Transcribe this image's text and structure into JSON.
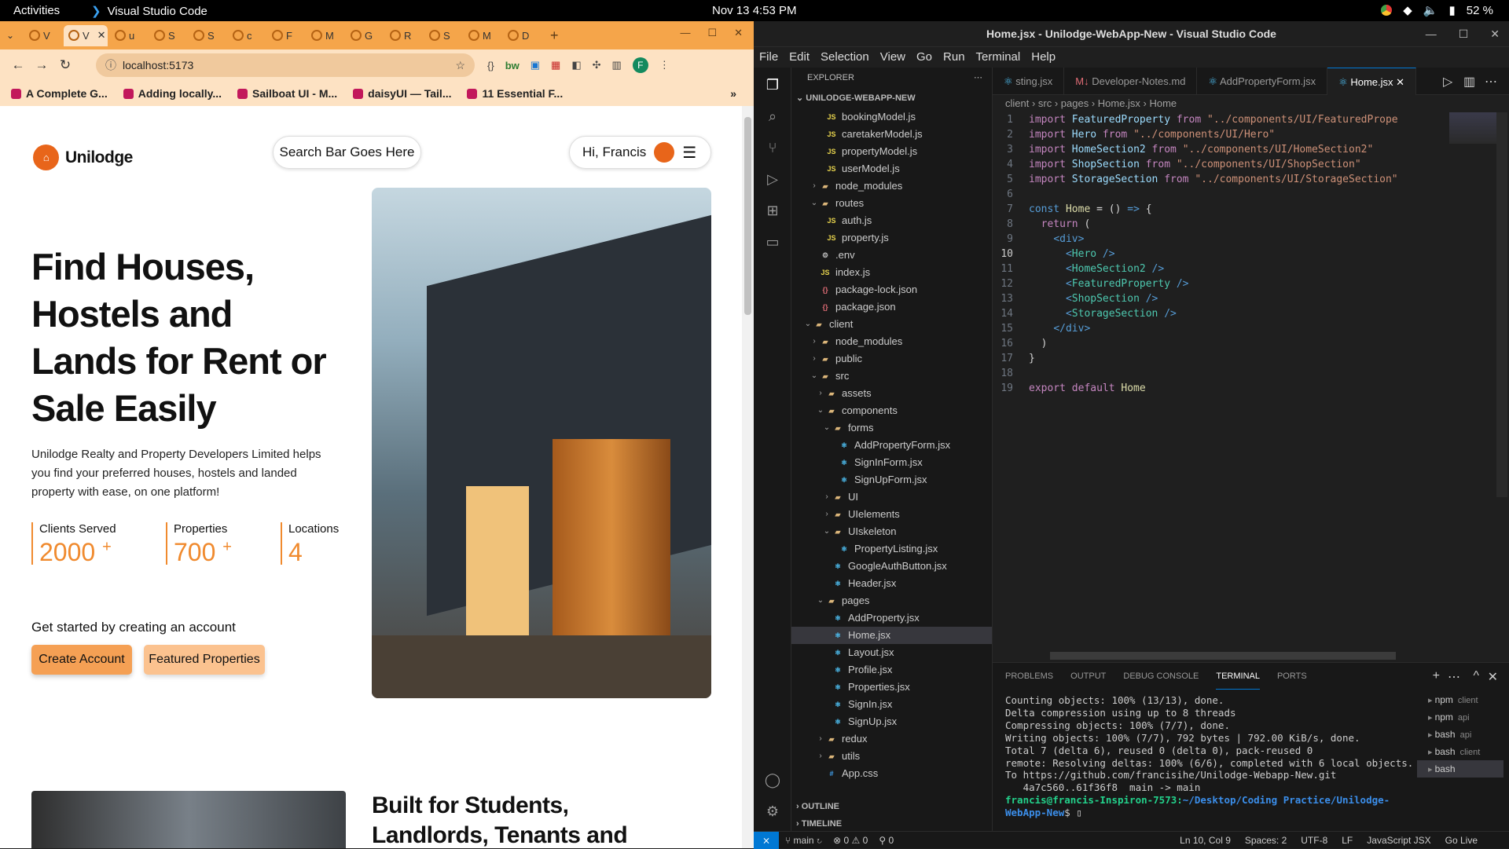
{
  "topbar": {
    "activities": "Activities",
    "app": "Visual Studio Code",
    "clock": "Nov 13  4:53 PM",
    "battery": "52 %"
  },
  "browser": {
    "tabs": [
      "V",
      "V",
      "u",
      "S",
      "S",
      "c",
      "F",
      "M",
      "G",
      "R",
      "S",
      "M",
      "D"
    ],
    "active_tab": 1,
    "url": "localhost:5173",
    "bookmarks": [
      "A Complete G...",
      "Adding locally...",
      "Sailboat UI - M...",
      "daisyUI — Tail...",
      "11 Essential F..."
    ]
  },
  "site": {
    "brand": "Unilodge",
    "search_placeholder": "Search Bar Goes Here",
    "greeting": "Hi, Francis",
    "headline": "Find Houses, Hostels and Lands for Rent or Sale Easily",
    "description": "Unilodge Realty and Property Developers Limited helps you find your preferred houses, hostels and landed property with ease, on one platform!",
    "stats": [
      {
        "label": "Clients Served",
        "value": "2000",
        "suffix": "+"
      },
      {
        "label": "Properties",
        "value": "700",
        "suffix": "+"
      },
      {
        "label": "Locations",
        "value": "4",
        "suffix": ""
      }
    ],
    "get_started": "Get started by creating an account",
    "create_account": "Create Account",
    "featured": "Featured Properties",
    "section2_title": "Built for Students, Landlords, Tenants and Developers"
  },
  "vscode": {
    "title": "Home.jsx - Unilodge-WebApp-New - Visual Studio Code",
    "menu": [
      "File",
      "Edit",
      "Selection",
      "View",
      "Go",
      "Run",
      "Terminal",
      "Help"
    ],
    "explorer_title": "EXPLORER",
    "project": "UNILODGE-WEBAPP-NEW",
    "tree": [
      {
        "name": "bookingModel.js",
        "depth": 3,
        "icon": "js",
        "chev": ""
      },
      {
        "name": "caretakerModel.js",
        "depth": 3,
        "icon": "js",
        "chev": ""
      },
      {
        "name": "propertyModel.js",
        "depth": 3,
        "icon": "js",
        "chev": ""
      },
      {
        "name": "userModel.js",
        "depth": 3,
        "icon": "js",
        "chev": ""
      },
      {
        "name": "node_modules",
        "depth": 2,
        "icon": "folder",
        "chev": ">"
      },
      {
        "name": "routes",
        "depth": 2,
        "icon": "folder",
        "chev": "v"
      },
      {
        "name": "auth.js",
        "depth": 3,
        "icon": "js",
        "chev": ""
      },
      {
        "name": "property.js",
        "depth": 3,
        "icon": "js",
        "chev": ""
      },
      {
        "name": ".env",
        "depth": 2,
        "icon": "gear",
        "chev": ""
      },
      {
        "name": "index.js",
        "depth": 2,
        "icon": "js",
        "chev": ""
      },
      {
        "name": "package-lock.json",
        "depth": 2,
        "icon": "json",
        "chev": ""
      },
      {
        "name": "package.json",
        "depth": 2,
        "icon": "json",
        "chev": ""
      },
      {
        "name": "client",
        "depth": 1,
        "icon": "folder",
        "chev": "v"
      },
      {
        "name": "node_modules",
        "depth": 2,
        "icon": "folder",
        "chev": ">"
      },
      {
        "name": "public",
        "depth": 2,
        "icon": "folder",
        "chev": ">"
      },
      {
        "name": "src",
        "depth": 2,
        "icon": "folder",
        "chev": "v"
      },
      {
        "name": "assets",
        "depth": 3,
        "icon": "folder",
        "chev": ">"
      },
      {
        "name": "components",
        "depth": 3,
        "icon": "folder",
        "chev": "v"
      },
      {
        "name": "forms",
        "depth": 4,
        "icon": "folder",
        "chev": "v"
      },
      {
        "name": "AddPropertyForm.jsx",
        "depth": 5,
        "icon": "react",
        "chev": ""
      },
      {
        "name": "SignInForm.jsx",
        "depth": 5,
        "icon": "react",
        "chev": ""
      },
      {
        "name": "SignUpForm.jsx",
        "depth": 5,
        "icon": "react",
        "chev": ""
      },
      {
        "name": "UI",
        "depth": 4,
        "icon": "folder",
        "chev": ">"
      },
      {
        "name": "UIelements",
        "depth": 4,
        "icon": "folder",
        "chev": ">"
      },
      {
        "name": "UIskeleton",
        "depth": 4,
        "icon": "folder",
        "chev": "v"
      },
      {
        "name": "PropertyListing.jsx",
        "depth": 5,
        "icon": "react",
        "chev": ""
      },
      {
        "name": "GoogleAuthButton.jsx",
        "depth": 4,
        "icon": "react",
        "chev": ""
      },
      {
        "name": "Header.jsx",
        "depth": 4,
        "icon": "react",
        "chev": ""
      },
      {
        "name": "pages",
        "depth": 3,
        "icon": "folder",
        "chev": "v"
      },
      {
        "name": "AddProperty.jsx",
        "depth": 4,
        "icon": "react",
        "chev": ""
      },
      {
        "name": "Home.jsx",
        "depth": 4,
        "icon": "react",
        "chev": "",
        "selected": true
      },
      {
        "name": "Layout.jsx",
        "depth": 4,
        "icon": "react",
        "chev": ""
      },
      {
        "name": "Profile.jsx",
        "depth": 4,
        "icon": "react",
        "chev": ""
      },
      {
        "name": "Properties.jsx",
        "depth": 4,
        "icon": "react",
        "chev": ""
      },
      {
        "name": "SignIn.jsx",
        "depth": 4,
        "icon": "react",
        "chev": ""
      },
      {
        "name": "SignUp.jsx",
        "depth": 4,
        "icon": "react",
        "chev": ""
      },
      {
        "name": "redux",
        "depth": 3,
        "icon": "folder",
        "chev": ">"
      },
      {
        "name": "utils",
        "depth": 3,
        "icon": "folder",
        "chev": ">"
      },
      {
        "name": "App.css",
        "depth": 3,
        "icon": "css",
        "chev": ""
      }
    ],
    "outline": "OUTLINE",
    "timeline": "TIMELINE",
    "tabs": [
      {
        "name": "sting.jsx",
        "active": false
      },
      {
        "name": "Developer-Notes.md",
        "active": false
      },
      {
        "name": "AddPropertyForm.jsx",
        "active": false
      },
      {
        "name": "Home.jsx",
        "active": true
      }
    ],
    "breadcrumb": "client › src › pages › Home.jsx › Home",
    "code": [
      [
        [
          "kw",
          "import "
        ],
        [
          "id",
          "FeaturedProperty"
        ],
        [
          "kw",
          " from "
        ],
        [
          "str",
          "\"../components/UI/FeaturedPrope"
        ]
      ],
      [
        [
          "kw",
          "import "
        ],
        [
          "id",
          "Hero"
        ],
        [
          "kw",
          " from "
        ],
        [
          "str",
          "\"../components/UI/Hero\""
        ]
      ],
      [
        [
          "kw",
          "import "
        ],
        [
          "id",
          "HomeSection2"
        ],
        [
          "kw",
          " from "
        ],
        [
          "str",
          "\"../components/UI/HomeSection2\""
        ]
      ],
      [
        [
          "kw",
          "import "
        ],
        [
          "id",
          "ShopSection"
        ],
        [
          "kw",
          " from "
        ],
        [
          "str",
          "\"../components/UI/ShopSection\""
        ]
      ],
      [
        [
          "kw",
          "import "
        ],
        [
          "id",
          "StorageSection"
        ],
        [
          "kw",
          " from "
        ],
        [
          "str",
          "\"../components/UI/StorageSection\""
        ]
      ],
      [],
      [
        [
          "tag",
          "const "
        ],
        [
          "fn",
          "Home"
        ],
        [
          "pl",
          " = () "
        ],
        [
          "tag",
          "=>"
        ],
        [
          "pl",
          " {"
        ]
      ],
      [
        [
          "pl",
          "  "
        ],
        [
          "kw",
          "return"
        ],
        [
          "pl",
          " ("
        ]
      ],
      [
        [
          "pl",
          "    "
        ],
        [
          "tag",
          "<div>"
        ]
      ],
      [
        [
          "pl",
          "      "
        ],
        [
          "tag",
          "<"
        ],
        [
          "cmp",
          "Hero"
        ],
        [
          "tag",
          " />"
        ]
      ],
      [
        [
          "pl",
          "      "
        ],
        [
          "tag",
          "<"
        ],
        [
          "cmp",
          "HomeSection2"
        ],
        [
          "tag",
          " />"
        ]
      ],
      [
        [
          "pl",
          "      "
        ],
        [
          "tag",
          "<"
        ],
        [
          "cmp",
          "FeaturedProperty"
        ],
        [
          "tag",
          " />"
        ]
      ],
      [
        [
          "pl",
          "      "
        ],
        [
          "tag",
          "<"
        ],
        [
          "cmp",
          "ShopSection"
        ],
        [
          "tag",
          " />"
        ]
      ],
      [
        [
          "pl",
          "      "
        ],
        [
          "tag",
          "<"
        ],
        [
          "cmp",
          "StorageSection"
        ],
        [
          "tag",
          " />"
        ]
      ],
      [
        [
          "pl",
          "    "
        ],
        [
          "tag",
          "</div>"
        ]
      ],
      [
        [
          "pl",
          "  )"
        ]
      ],
      [
        [
          "pl",
          "}"
        ]
      ],
      [],
      [
        [
          "kw",
          "export default "
        ],
        [
          "fn",
          "Home"
        ]
      ]
    ],
    "current_line": 10,
    "panel_tabs": [
      "PROBLEMS",
      "OUTPUT",
      "DEBUG CONSOLE",
      "TERMINAL",
      "PORTS"
    ],
    "terminal": "Counting objects: 100% (13/13), done.\nDelta compression using up to 8 threads\nCompressing objects: 100% (7/7), done.\nWriting objects: 100% (7/7), 792 bytes | 792.00 KiB/s, done.\nTotal 7 (delta 6), reused 0 (delta 0), pack-reused 0\nremote: Resolving deltas: 100% (6/6), completed with 6 local objects.\nTo https://github.com/francisihe/Unilodge-Webapp-New.git\n   4a7c560..61f36f8  main -> main",
    "prompt_user": "francis@francis-Inspiron-7573:",
    "prompt_path": "~/Desktop/Coding Practice/Unilodge-WebApp-New",
    "terminals": [
      {
        "name": "npm",
        "tag": "client"
      },
      {
        "name": "npm",
        "tag": "api"
      },
      {
        "name": "bash",
        "tag": "api"
      },
      {
        "name": "bash",
        "tag": "client"
      },
      {
        "name": "bash",
        "tag": ""
      }
    ],
    "status": {
      "branch": "main",
      "errors": "0",
      "warnings": "0",
      "ports": "0",
      "position": "Ln 10, Col 9",
      "spaces": "Spaces: 2",
      "encoding": "UTF-8",
      "eol": "LF",
      "language": "JavaScript JSX",
      "golive": "Go Live"
    }
  }
}
